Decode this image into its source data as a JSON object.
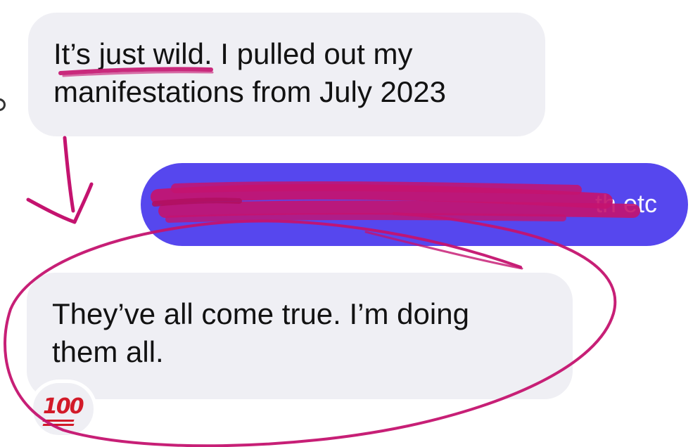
{
  "conversation": {
    "messages": [
      {
        "direction": "incoming",
        "lines": [
          "It’s just wild. I pulled out my",
          "manifestations from July 2023"
        ]
      },
      {
        "direction": "outgoing",
        "visible_text": "th etc",
        "redacted": true
      },
      {
        "direction": "incoming",
        "lines": [
          "They’ve all come true. I’m doing",
          "them all."
        ],
        "reaction": "💯"
      }
    ]
  },
  "colors": {
    "incoming_bubble": "#efeff4",
    "outgoing_bubble": "#5647ee",
    "ink": "#c4136f",
    "reaction": "#d21a28"
  },
  "annotations": [
    "underline",
    "down-arrow",
    "redaction-scribble",
    "ellipse-circle"
  ]
}
